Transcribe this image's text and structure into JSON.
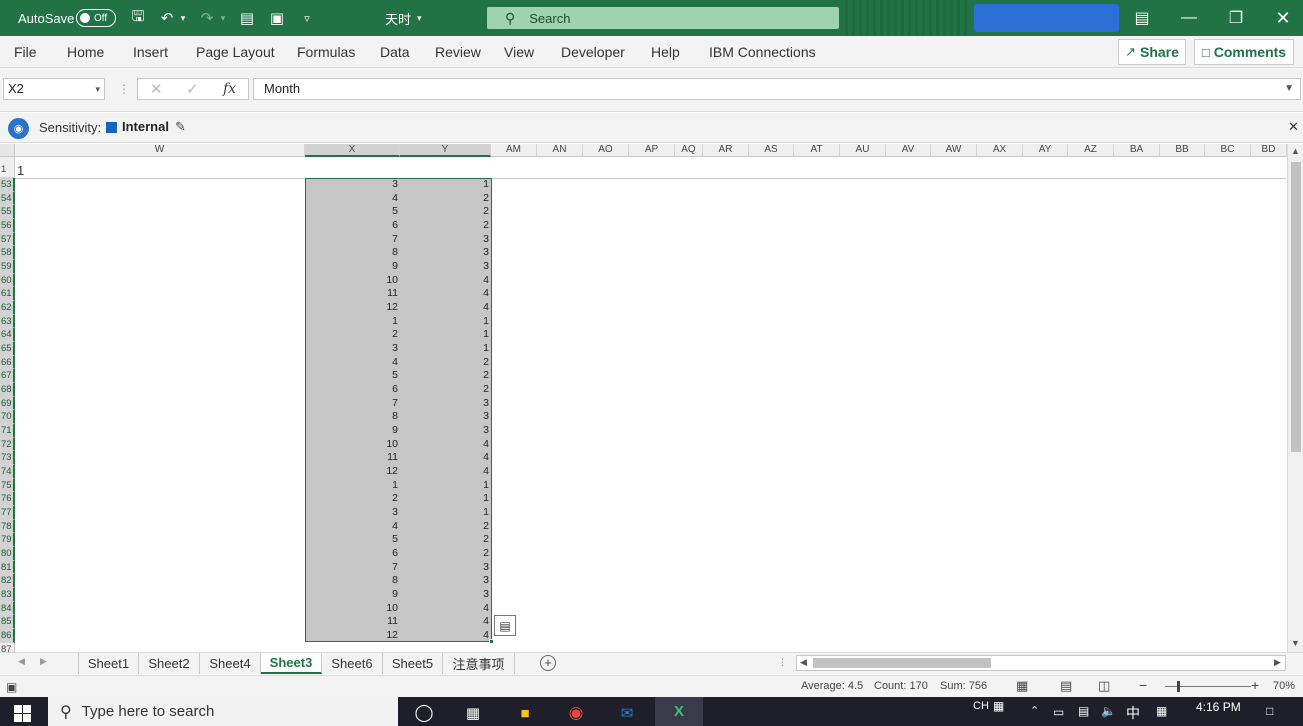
{
  "titlebar": {
    "autosave_label": "AutoSave",
    "autosave_state": "Off",
    "doc_name": "天时",
    "search_placeholder": "Search",
    "colors": {
      "bar": "#217346",
      "account": "#2a6fd6"
    }
  },
  "ribbon": {
    "tabs": [
      "File",
      "Home",
      "Insert",
      "Page Layout",
      "Formulas",
      "Data",
      "Review",
      "View",
      "Developer",
      "Help",
      "IBM Connections"
    ],
    "share_label": "Share",
    "comments_label": "Comments"
  },
  "formula_bar": {
    "name_box": "X2",
    "formula": "Month"
  },
  "sensitivity": {
    "label": "Sensitivity:",
    "value": "Internal",
    "swatch_color": "#1565c0"
  },
  "grid": {
    "columns": [
      "W",
      "X",
      "Y",
      "AM",
      "AN",
      "AO",
      "AP",
      "AQ",
      "AR",
      "AS",
      "AT",
      "AU",
      "AV",
      "AW",
      "AX",
      "AY",
      "AZ",
      "BA",
      "BB",
      "BC",
      "BD"
    ],
    "row1_value": "1",
    "row_numbers": [
      "1",
      "53",
      "54",
      "55",
      "56",
      "57",
      "58",
      "59",
      "60",
      "61",
      "62",
      "63",
      "64",
      "65",
      "66",
      "67",
      "68",
      "69",
      "70",
      "71",
      "72",
      "73",
      "74",
      "75",
      "76",
      "77",
      "78",
      "79",
      "80",
      "81",
      "82",
      "83",
      "84",
      "85",
      "86",
      "87"
    ],
    "col_x": [
      "3",
      "4",
      "5",
      "6",
      "7",
      "8",
      "9",
      "10",
      "11",
      "12",
      "1",
      "2",
      "3",
      "4",
      "5",
      "6",
      "7",
      "8",
      "9",
      "10",
      "11",
      "12",
      "1",
      "2",
      "3",
      "4",
      "5",
      "6",
      "7",
      "8",
      "9",
      "10",
      "11",
      "12"
    ],
    "col_y": [
      "1",
      "2",
      "2",
      "2",
      "3",
      "3",
      "3",
      "4",
      "4",
      "4",
      "1",
      "1",
      "1",
      "2",
      "2",
      "2",
      "3",
      "3",
      "3",
      "4",
      "4",
      "4",
      "1",
      "1",
      "1",
      "2",
      "2",
      "2",
      "3",
      "3",
      "3",
      "4",
      "4",
      "4"
    ]
  },
  "sheets": {
    "tabs": [
      "Sheet1",
      "Sheet2",
      "Sheet4",
      "Sheet3",
      "Sheet6",
      "Sheet5",
      "注意事项"
    ],
    "active": "Sheet3"
  },
  "statusbar": {
    "average": "Average: 4.5",
    "count": "Count: 170",
    "sum": "Sum: 756",
    "zoom": "70%"
  },
  "taskbar": {
    "search_placeholder": "Type here to search",
    "lang": "CH",
    "ime": "中",
    "time": "4:16 PM"
  }
}
